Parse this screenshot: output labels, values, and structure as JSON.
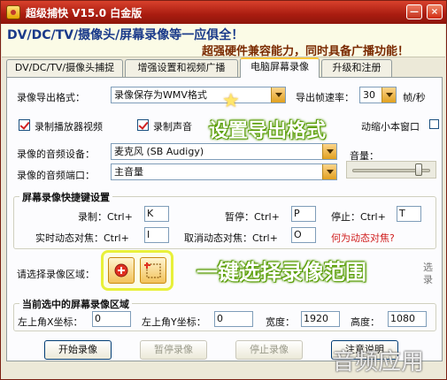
{
  "window": {
    "title": "超级捕快 V15.0 白金版"
  },
  "titlebar_buttons": {
    "minimize": "—",
    "close": "×"
  },
  "banner": {
    "line1": "DV/DC/TV/摄像头/屏幕录像等一应俱全！",
    "line2": "超强硬件兼容能力，同时具备广播功能！"
  },
  "tabs": [
    {
      "label": "DV/DC/TV/摄像头捕捉"
    },
    {
      "label": "增强设置和视频广播"
    },
    {
      "label": "电脑屏幕录像",
      "active": true
    },
    {
      "label": "升级和注册"
    }
  ],
  "export": {
    "format_label": "录像导出格式：",
    "format_value": "录像保存为WMV格式",
    "fps_label": "导出帧速率：",
    "fps_value": "30",
    "fps_unit": "帧/秒"
  },
  "options": {
    "record_player": "录制播放器视频",
    "record_sound": "录制声音",
    "mini_window": "动缩小本窗口"
  },
  "audio": {
    "device_label": "录像的音频设备：",
    "device_value": "麦克风 (SB Audigy)",
    "port_label": "录像的音频端口：",
    "port_value": "主音量",
    "volume_label": "音量：",
    "volume_level": 0.85
  },
  "hotkeys": {
    "group_title": "屏幕录像快捷键设置",
    "record_label": "录制：Ctrl+",
    "record_key": "K",
    "pause_label": "暂停：Ctrl+",
    "pause_key": "P",
    "stop_label": "停止：Ctrl+",
    "stop_key": "T",
    "realtime_label": "实时动态对焦：Ctrl+",
    "realtime_key": "I",
    "cancel_focus_label": "取消动态对焦：Ctrl+",
    "cancel_focus_key": "O",
    "what_is_focus": "何为动态对焦?"
  },
  "region": {
    "select_label": "请选择录像区域：",
    "trailing_text": "选",
    "trailing_text2": "录"
  },
  "current_region": {
    "group_title": "当前选中的屏幕录像区域",
    "x_label": "左上角X坐标：",
    "x_value": "0",
    "y_label": "左上角Y坐标：",
    "y_value": "0",
    "width_label": "宽度：",
    "width_value": "1920",
    "height_label": "高度：",
    "height_value": "1080"
  },
  "actions": {
    "start": "开始录像",
    "pause": "暂停录像",
    "stop": "停止录像",
    "help": "注意说明"
  },
  "annotations": {
    "set_format": "设置导出格式",
    "one_click": "一键选择录像范围"
  },
  "watermark": "音频应用"
}
